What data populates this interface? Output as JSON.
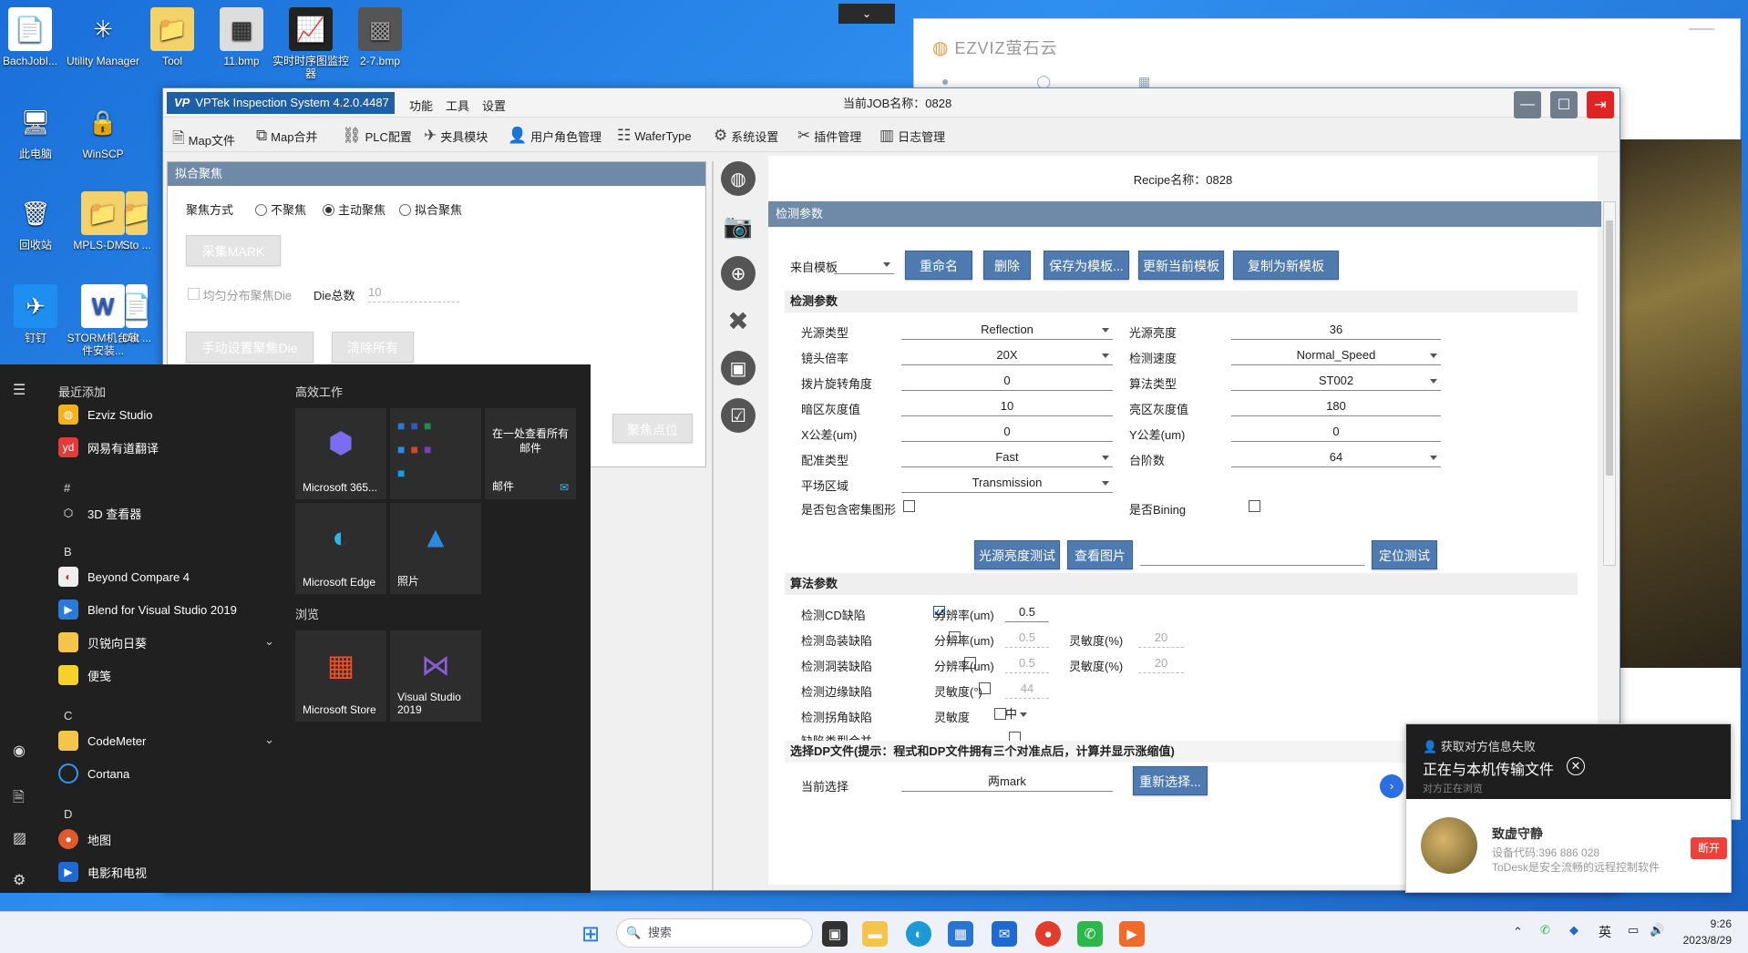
{
  "desktop": {
    "icons": [
      {
        "label": "BachJobI...",
        "glyph": "📄"
      },
      {
        "label": "Utility Manager",
        "glyph": "✳"
      },
      {
        "label": "Tool",
        "glyph": "📁"
      },
      {
        "label": "11.bmp",
        "glyph": "▦"
      },
      {
        "label": "实时时序图监控器",
        "glyph": "📈"
      },
      {
        "label": "2-7.bmp",
        "glyph": "▩"
      },
      {
        "label": "此电脑",
        "glyph": "🖥"
      },
      {
        "label": "WinSCP",
        "glyph": "🔒"
      },
      {
        "label": "回收站",
        "glyph": "🗑"
      },
      {
        "label": "MPLS-DM...",
        "glyph": "📁"
      },
      {
        "label": "Sto ...",
        "glyph": "📁"
      },
      {
        "label": "钉钉",
        "glyph": "✈"
      },
      {
        "label": "STORM机台软件安装...",
        "glyph": "W"
      },
      {
        "label": "Dat ...",
        "glyph": "📄"
      }
    ]
  },
  "ezviz": {
    "logo": "EZVIZ萤石云"
  },
  "app": {
    "title": "VPTek Inspection System 4.2.0.4487",
    "logo": "VP",
    "menus": [
      "功能",
      "工具",
      "设置"
    ],
    "job_label": "当前JOB名称：0828",
    "toolbar": [
      "Map文件",
      "Map合并",
      "PLC配置",
      "夹具模块",
      "用户角色管理",
      "WaferType",
      "系统设置",
      "插件管理",
      "日志管理"
    ],
    "left_panel": {
      "title": "拟合聚焦",
      "focus_mode_label": "聚焦方式",
      "radios": [
        "不聚焦",
        "主动聚焦",
        "拟合聚焦"
      ],
      "collect_mark": "采集MARK",
      "uniform_die": "均匀分布聚焦Die",
      "die_total_label": "Die总数",
      "die_total_value": "10",
      "manual_btn": "手动设置聚焦Die",
      "clear_btn": "清除所有",
      "focus_point_btn": "聚焦点位"
    },
    "recipe": "Recipe名称：0828",
    "detect_header": "检测参数",
    "template": {
      "label": "来自模板",
      "buttons": [
        "重命名",
        "删除",
        "保存为模板...",
        "更新当前模板",
        "复制为新模板"
      ]
    },
    "detect_group": "检测参数",
    "params_left": [
      {
        "label": "光源类型",
        "value": "Reflection"
      },
      {
        "label": "镜头倍率",
        "value": "20X"
      },
      {
        "label": "拨片旋转角度",
        "value": "0"
      },
      {
        "label": "暗区灰度值",
        "value": "10"
      },
      {
        "label": "X公差(um)",
        "value": "0"
      },
      {
        "label": "配准类型",
        "value": "Fast"
      },
      {
        "label": "平场区域",
        "value": "Transmission"
      },
      {
        "label": "是否包含密集图形",
        "value": ""
      }
    ],
    "params_right": [
      {
        "label": "光源亮度",
        "value": "36"
      },
      {
        "label": "检测速度",
        "value": "Normal_Speed"
      },
      {
        "label": "算法类型",
        "value": "ST002"
      },
      {
        "label": "亮区灰度值",
        "value": "180"
      },
      {
        "label": "Y公差(um)",
        "value": "0"
      },
      {
        "label": "台阶数",
        "value": "64"
      },
      {
        "label": "是否Bining",
        "value": ""
      }
    ],
    "test_buttons": [
      "光源亮度测试",
      "查看图片",
      "定位测试"
    ],
    "algo_group": "算法参数",
    "algo": [
      {
        "label": "检测CD缺陷",
        "res_label": "分辨率(um)",
        "res": "0.5"
      },
      {
        "label": "检测岛装缺陷",
        "res_label": "分辨率(um)",
        "res": "0.5",
        "sens_label": "灵敏度(%)",
        "sens": "20"
      },
      {
        "label": "检测洞装缺陷",
        "res_label": "分辨率(um)",
        "res": "0.5",
        "sens_label": "灵敏度(%)",
        "sens": "20"
      },
      {
        "label": "检测边缘缺陷",
        "res_label": "灵敏度(°)",
        "res": "44"
      },
      {
        "label": "检测拐角缺陷",
        "res_label": "灵敏度",
        "res": "中"
      },
      {
        "label": "缺陷类型合并"
      }
    ],
    "dp_group": "选择DP文件(提示：程式和DP文件拥有三个对准点后，计算并显示涨缩值)",
    "dp_current_label": "当前选择",
    "dp_current_value": "两mark",
    "dp_reselect": "重新选择..."
  },
  "start_menu": {
    "recent_header": "最近添加",
    "recent": [
      {
        "label": "Ezviz Studio",
        "color": "#f2b21e"
      },
      {
        "label": "网易有道翻译",
        "color": "#e43a3a",
        "glyph": "yd"
      }
    ],
    "letters": [
      "#",
      "B",
      "C",
      "D"
    ],
    "apps": [
      {
        "label": "3D 查看器"
      },
      {
        "label": "Beyond Compare 4"
      },
      {
        "label": "Blend for Visual Studio 2019"
      },
      {
        "label": "贝锐向日葵"
      },
      {
        "label": "便笺"
      },
      {
        "label": "CodeMeter"
      },
      {
        "label": "Cortana"
      },
      {
        "label": "地图"
      },
      {
        "label": "电影和电视"
      }
    ],
    "productive_header": "高效工作",
    "browse_header": "浏览",
    "tiles": [
      "Microsoft 365...",
      "在一处查看所有邮件",
      "邮件",
      "Microsoft Edge",
      "照片",
      "Microsoft Store",
      "Visual Studio 2019"
    ]
  },
  "todesk": {
    "fail_text": "获取对方信息失败",
    "transfer_text": "正在与本机传输文件",
    "waiting_text": "对方正在浏览",
    "name": "致虚守静",
    "device_code": "设备代码:396 886 028",
    "tagline": "ToDesk是安全流畅的远程控制软件",
    "disconnect": "断开"
  },
  "taskbar": {
    "search_placeholder": "搜索",
    "ime": "英",
    "time": "9:26",
    "date": "2023/8/29"
  }
}
